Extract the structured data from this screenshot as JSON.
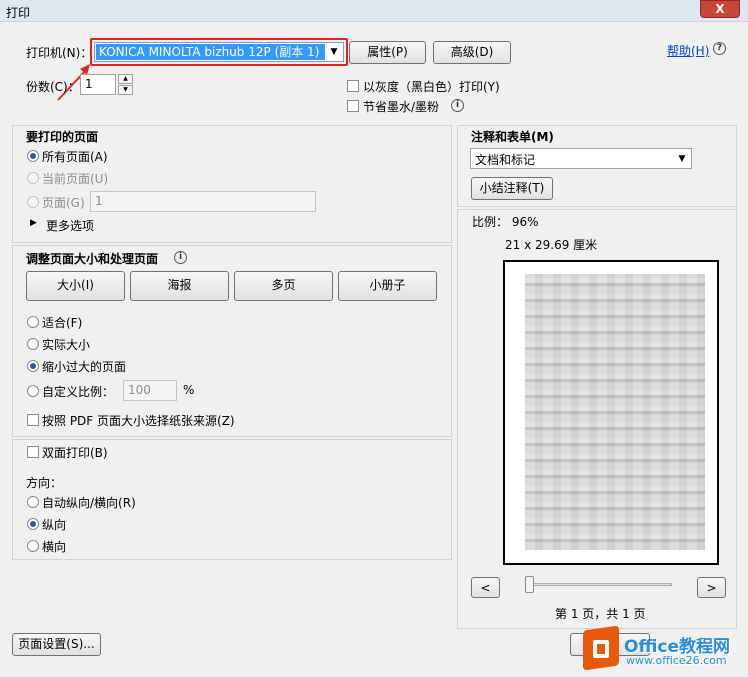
{
  "window": {
    "title": "打印",
    "close_label": "X"
  },
  "printer": {
    "label": "打印机(N)：",
    "selected": "KONICA MINOLTA bizhub 12P (副本 1)",
    "properties_btn": "属性(P)",
    "advanced_btn": "高级(D)",
    "help_link": "帮助(H)"
  },
  "copies": {
    "label": "份数(C)：",
    "value": "1"
  },
  "options": {
    "grayscale": "以灰度（黑白色）打印(Y)",
    "save_ink": "节省墨水/墨粉"
  },
  "pages": {
    "heading": "要打印的页面",
    "all": "所有页面(A)",
    "current": "当前页面(U)",
    "range": "页面(G)",
    "range_value": "1",
    "more": "更多选项"
  },
  "sizing": {
    "heading": "调整页面大小和处理页面",
    "buttons": [
      "大小(I)",
      "海报",
      "多页",
      "小册子"
    ],
    "fit": "适合(F)",
    "actual": "实际大小",
    "shrink": "缩小过大的页面",
    "custom": "自定义比例：",
    "custom_value": "100",
    "percent": "%",
    "choose_source": "按照 PDF 页面大小选择纸张来源(Z)"
  },
  "duplex": {
    "label": "双面打印(B)"
  },
  "orientation": {
    "heading": "方向：",
    "auto": "自动纵向/横向(R)",
    "portrait": "纵向",
    "landscape": "横向"
  },
  "comments": {
    "heading": "注释和表单(M)",
    "selected": "文档和标记",
    "summarize_btn": "小结注释(T)"
  },
  "preview": {
    "scale": "比例： 96%",
    "size": "21 x 29.69 厘米",
    "prev": "<",
    "next": ">",
    "page_info": "第 1 页，共 1 页"
  },
  "footer": {
    "page_setup_btn": "页面设置(S)..."
  },
  "watermark": {
    "brand": "Office教程网",
    "url": "www.office26.com"
  }
}
